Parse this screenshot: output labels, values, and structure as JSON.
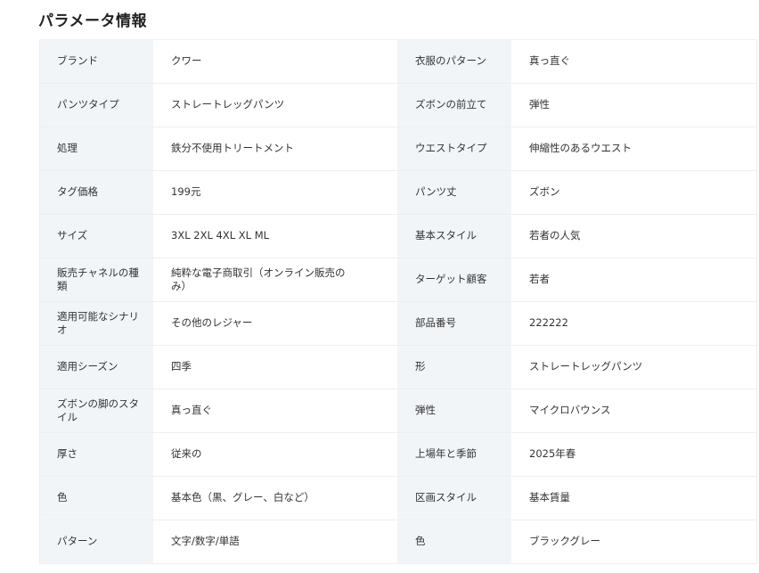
{
  "title": "パラメータ情報",
  "rows": [
    {
      "k1": "ブランド",
      "v1": "クワー",
      "k2": "衣服のパターン",
      "v2": "真っ直ぐ"
    },
    {
      "k1": "パンツタイプ",
      "v1": "ストレートレッグパンツ",
      "k2": "ズボンの前立て",
      "v2": "弾性"
    },
    {
      "k1": "処理",
      "v1": "鉄分不使用トリートメント",
      "k2": "ウエストタイプ",
      "v2": "伸縮性のあるウエスト"
    },
    {
      "k1": "タグ価格",
      "v1": "199元",
      "k2": "パンツ丈",
      "v2": "ズボン"
    },
    {
      "k1": "サイズ",
      "v1": "3XL 2XL 4XL XL ML",
      "k2": "基本スタイル",
      "v2": "若者の人気"
    },
    {
      "k1": "販売チャネルの種類",
      "v1": "純粋な電子商取引（オンライン販売のみ）",
      "k2": "ターゲット顧客",
      "v2": "若者"
    },
    {
      "k1": "適用可能なシナリオ",
      "v1": "その他のレジャー",
      "k2": "部品番号",
      "v2": "222222"
    },
    {
      "k1": "適用シーズン",
      "v1": "四季",
      "k2": "形",
      "v2": "ストレートレッグパンツ"
    },
    {
      "k1": "ズボンの脚のスタイル",
      "v1": "真っ直ぐ",
      "k2": "弾性",
      "v2": "マイクロバウンス"
    },
    {
      "k1": "厚さ",
      "v1": "従来の",
      "k2": "上場年と季節",
      "v2": "2025年春"
    },
    {
      "k1": "色",
      "v1": "基本色（黒、グレー、白など）",
      "k2": "区画スタイル",
      "v2": "基本賃量"
    },
    {
      "k1": "パターン",
      "v1": "文字/数字/単語",
      "k2": "色",
      "v2": "ブラックグレー"
    }
  ]
}
